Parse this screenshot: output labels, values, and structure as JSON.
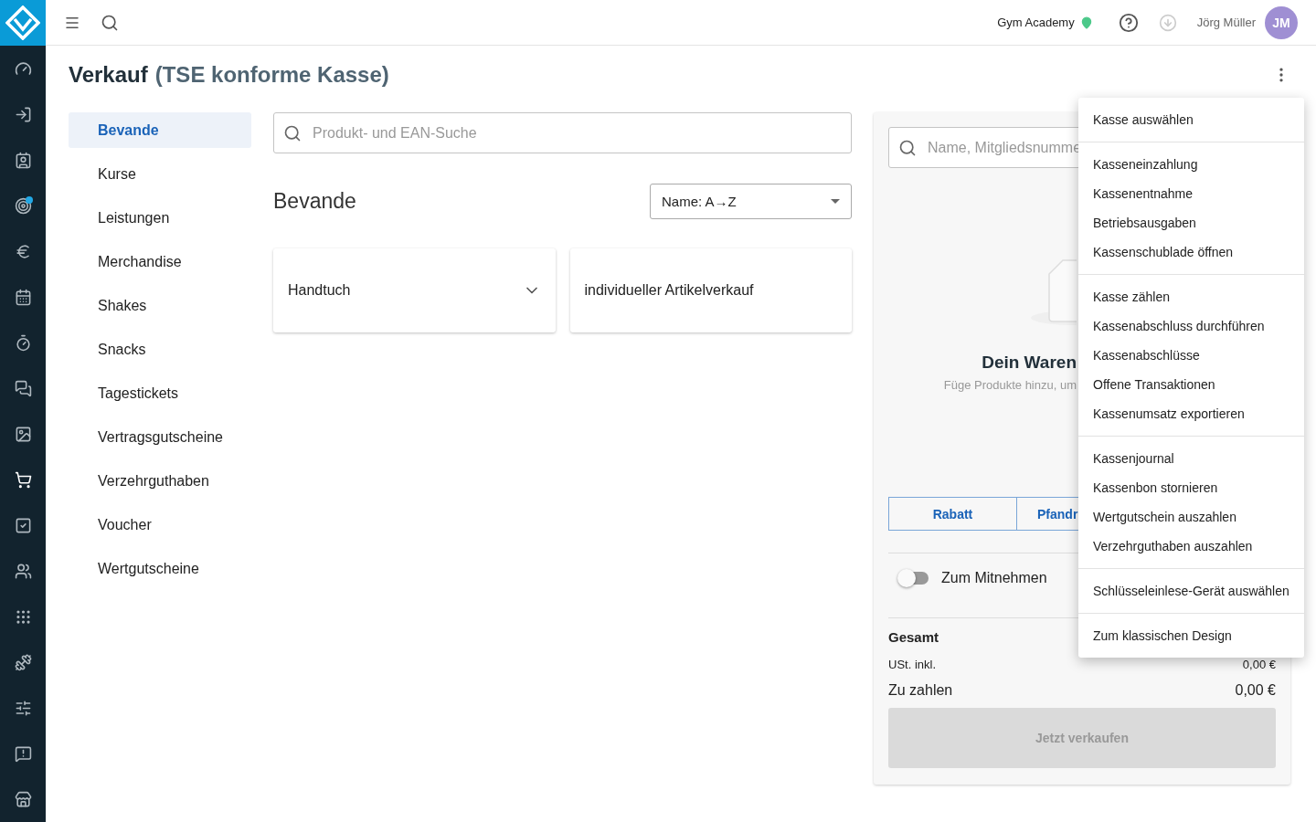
{
  "nav": [
    {
      "selected": false,
      "notification": false
    },
    {
      "selected": false,
      "notification": false
    },
    {
      "selected": false,
      "notification": false
    },
    {
      "selected": false,
      "notification": true
    },
    {
      "selected": false,
      "notification": false
    },
    {
      "selected": false,
      "notification": false
    },
    {
      "selected": false,
      "notification": false
    },
    {
      "selected": false,
      "notification": false
    },
    {
      "selected": false,
      "notification": false
    },
    {
      "selected": true,
      "notification": false
    },
    {
      "selected": false,
      "notification": false
    },
    {
      "selected": false,
      "notification": false
    },
    {
      "selected": false,
      "notification": false
    },
    {
      "selected": false,
      "notification": false
    },
    {
      "selected": false,
      "notification": false
    },
    {
      "selected": false,
      "notification": false
    },
    {
      "selected": false,
      "notification": false
    }
  ],
  "topbar": {
    "studio": "Gym Academy",
    "user": "Jörg Müller",
    "initials": "JM"
  },
  "title": "Verkauf",
  "subtitle": "(TSE konforme Kasse)",
  "categories": [
    {
      "label": "Bevande",
      "selected": true
    },
    {
      "label": "Kurse",
      "selected": false
    },
    {
      "label": "Leistungen",
      "selected": false
    },
    {
      "label": "Merchandise",
      "selected": false
    },
    {
      "label": "Shakes",
      "selected": false
    },
    {
      "label": "Snacks",
      "selected": false
    },
    {
      "label": "Tagestickets",
      "selected": false
    },
    {
      "label": "Vertragsgutscheine",
      "selected": false
    },
    {
      "label": "Verzehrguthaben",
      "selected": false
    },
    {
      "label": "Voucher",
      "selected": false
    },
    {
      "label": "Wertgutscheine",
      "selected": false
    }
  ],
  "product_search": {
    "placeholder": "Produkt- und EAN-Suche"
  },
  "section_title": "Bevande",
  "sort": {
    "value": "Name: A→Z"
  },
  "products": [
    {
      "label": "Handtuch",
      "kind": "group"
    },
    {
      "label": "individueller Artikelverkauf",
      "kind": "single"
    }
  ],
  "cart": {
    "search_placeholder": "Name, Mitgliedsnumme",
    "empty_title": "Dein Waren",
    "empty_text": "Füge Produkte hinzu, um",
    "buttons": [
      "Rabatt",
      "Pfandr"
    ],
    "takeaway": {
      "label": "Zum Mitnehmen",
      "on": false
    },
    "total_label": "Gesamt",
    "vat_label": "USt. inkl.",
    "vat_value": "0,00 €",
    "pay_label": "Zu zahlen",
    "pay_value": "0,00 €",
    "sell_button": {
      "label": "Jetzt verkaufen",
      "disabled": true
    }
  },
  "menu": [
    [
      "Kasse auswählen"
    ],
    [
      "Kasseneinzahlung",
      "Kassenentnahme",
      "Betriebsausgaben",
      "Kassenschublade öffnen"
    ],
    [
      "Kasse zählen",
      "Kassenabschluss durchführen",
      "Kassenabschlüsse",
      "Offene Transaktionen",
      "Kassenumsatz exportieren"
    ],
    [
      "Kassenjournal",
      "Kassenbon stornieren",
      "Wertgutschein auszahlen",
      "Verzehrguthaben auszahlen"
    ],
    [
      "Schlüsseleinlese-Gerät auswählen"
    ],
    [
      "Zum klassischen Design"
    ]
  ]
}
